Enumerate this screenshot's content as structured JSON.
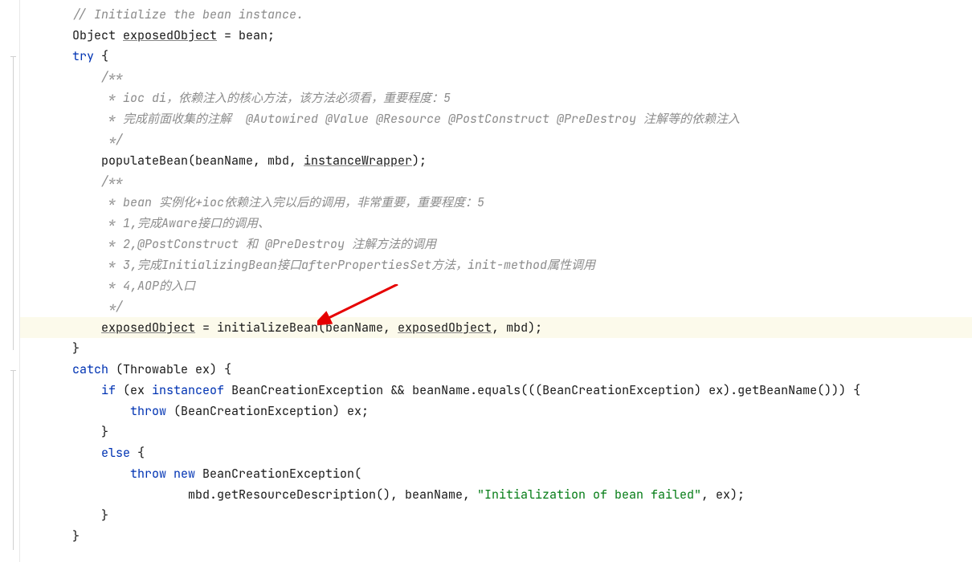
{
  "code": {
    "l1": "// Initialize the bean instance.",
    "l2a": "Object ",
    "l2b": "exposedObject",
    "l2c": " = bean;",
    "l3a": "try",
    "l3b": " {",
    "l4": "/**",
    "l5": " * ioc di，依赖注入的核心方法，该方法必须看，重要程度：5",
    "l6": " * 完成前面收集的注解  @Autowired @Value @Resource @PostConstruct @PreDestroy 注解等的依赖注入",
    "l7": " */",
    "l8a": "populateBean(beanName, mbd, ",
    "l8b": "instanceWrapper",
    "l8c": ");",
    "l9": "/**",
    "l10": " * bean 实例化+ioc依赖注入完以后的调用，非常重要，重要程度：5",
    "l11": " * 1,完成Aware接口的调用、",
    "l12": " * 2,@PostConstruct 和 @PreDestroy 注解方法的调用",
    "l13": " * 3,完成InitializingBean接口afterPropertiesSet方法，init-method属性调用",
    "l14": " * 4,AOP的入口",
    "l15": " */",
    "l16a": "exposedObject",
    "l16b": " = initializeBean(beanName, ",
    "l16c": "exposedObject",
    "l16d": ", mbd);",
    "l17": "}",
    "l18a": "catch",
    "l18b": " (Throwable ex) {",
    "l19a": "if",
    "l19b": " (ex ",
    "l19c": "instanceof",
    "l19d": " BeanCreationException && beanName.equals(((BeanCreationException) ex).getBeanName())) {",
    "l20a": "throw",
    "l20b": " (BeanCreationException) ex;",
    "l21": "}",
    "l22a": "else",
    "l22b": " {",
    "l23a": "throw new",
    "l23b": " BeanCreationException(",
    "l24a": "mbd.getResourceDescription(), beanName, ",
    "l24b": "\"Initialization of bean failed\"",
    "l24c": ", ex);",
    "l25": "}",
    "l26": "}"
  },
  "annotation": {
    "arrow_color": "#e60000",
    "target_line": 16
  }
}
